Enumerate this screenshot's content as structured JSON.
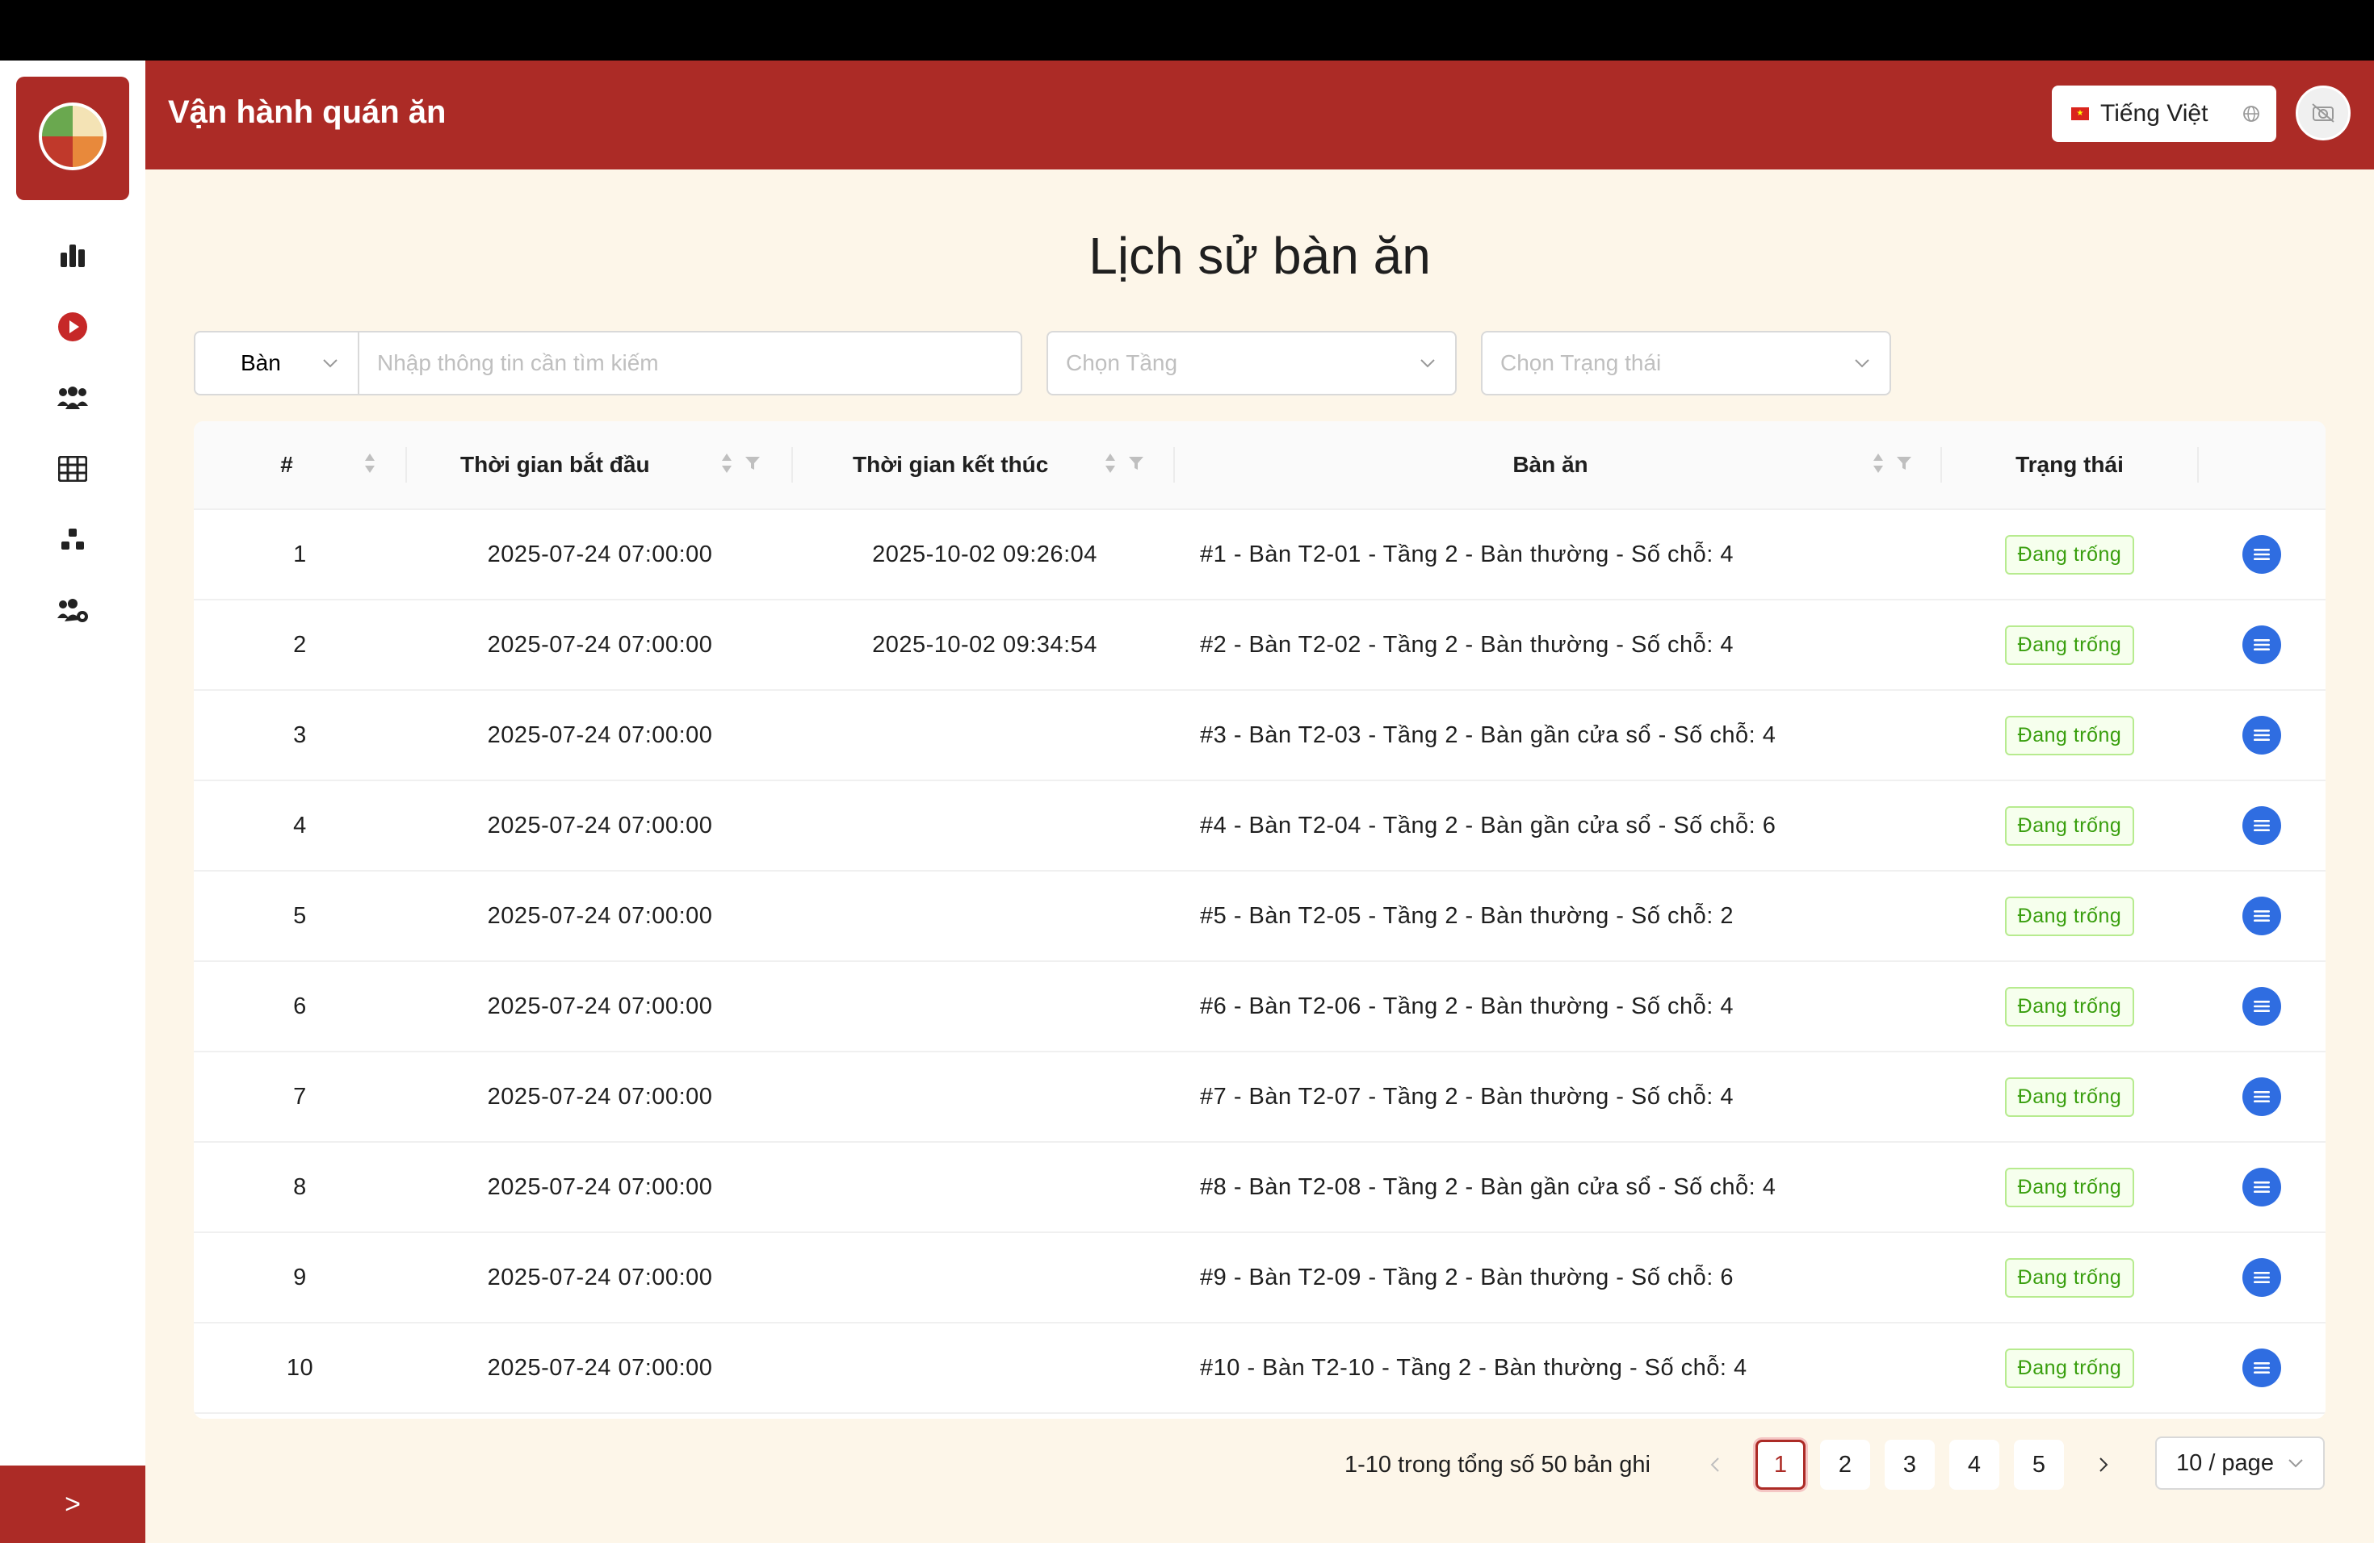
{
  "app": {
    "title": "Vận hành quán ăn"
  },
  "header": {
    "language_label": "Tiếng Việt",
    "language_icon": "globe-icon",
    "avatar_icon": "user-avatar"
  },
  "sidebar": {
    "items": [
      {
        "name": "dashboard",
        "icon": "bar-chart-icon"
      },
      {
        "name": "operations",
        "icon": "play-circle-icon"
      },
      {
        "name": "customers",
        "icon": "group-icon"
      },
      {
        "name": "tables",
        "icon": "table-grid-icon"
      },
      {
        "name": "categories",
        "icon": "cluster-icon"
      },
      {
        "name": "staff",
        "icon": "users-gear-icon"
      }
    ],
    "toggle_label": ">"
  },
  "page": {
    "title": "Lịch sử bàn ăn"
  },
  "filters": {
    "search_type": "Bàn",
    "search_placeholder": "Nhập thông tin cần tìm kiếm",
    "floor_placeholder": "Chọn Tầng",
    "status_placeholder": "Chọn Trạng thái"
  },
  "table": {
    "columns": {
      "index": "#",
      "start_time": "Thời gian bắt đầu",
      "end_time": "Thời gian kết thúc",
      "table": "Bàn ăn",
      "status": "Trạng thái"
    },
    "rows": [
      {
        "index": "1",
        "start": "2025-07-24 07:00:00",
        "end": "2025-10-02 09:26:04",
        "table": "#1 - Bàn T2-01 - Tầng 2 - Bàn thường - Số chỗ: 4",
        "status": "Đang trống"
      },
      {
        "index": "2",
        "start": "2025-07-24 07:00:00",
        "end": "2025-10-02 09:34:54",
        "table": "#2 - Bàn T2-02 - Tầng 2 - Bàn thường - Số chỗ: 4",
        "status": "Đang trống"
      },
      {
        "index": "3",
        "start": "2025-07-24 07:00:00",
        "end": "",
        "table": "#3 - Bàn T2-03 - Tầng 2 - Bàn gần cửa sổ - Số chỗ: 4",
        "status": "Đang trống"
      },
      {
        "index": "4",
        "start": "2025-07-24 07:00:00",
        "end": "",
        "table": "#4 - Bàn T2-04 - Tầng 2 - Bàn gần cửa sổ - Số chỗ: 6",
        "status": "Đang trống"
      },
      {
        "index": "5",
        "start": "2025-07-24 07:00:00",
        "end": "",
        "table": "#5 - Bàn T2-05 - Tầng 2 - Bàn thường - Số chỗ: 2",
        "status": "Đang trống"
      },
      {
        "index": "6",
        "start": "2025-07-24 07:00:00",
        "end": "",
        "table": "#6 - Bàn T2-06 - Tầng 2 - Bàn thường - Số chỗ: 4",
        "status": "Đang trống"
      },
      {
        "index": "7",
        "start": "2025-07-24 07:00:00",
        "end": "",
        "table": "#7 - Bàn T2-07 - Tầng 2 - Bàn thường - Số chỗ: 4",
        "status": "Đang trống"
      },
      {
        "index": "8",
        "start": "2025-07-24 07:00:00",
        "end": "",
        "table": "#8 - Bàn T2-08 - Tầng 2 - Bàn gần cửa sổ - Số chỗ: 4",
        "status": "Đang trống"
      },
      {
        "index": "9",
        "start": "2025-07-24 07:00:00",
        "end": "",
        "table": "#9 - Bàn T2-09 - Tầng 2 - Bàn thường - Số chỗ: 6",
        "status": "Đang trống"
      },
      {
        "index": "10",
        "start": "2025-07-24 07:00:00",
        "end": "",
        "table": "#10 - Bàn T2-10 - Tầng 2 - Bàn thường - Số chỗ: 4",
        "status": "Đang trống"
      }
    ]
  },
  "pagination": {
    "total_text": "1-10 trong tổng số 50 bản ghi",
    "pages": [
      "1",
      "2",
      "3",
      "4",
      "5"
    ],
    "current_page": "1",
    "page_size": "10 / page"
  },
  "colors": {
    "brand": "#ac2b26",
    "background": "#fdf6e9",
    "status_green": "#389e0d",
    "action_blue": "#2f6de1"
  }
}
